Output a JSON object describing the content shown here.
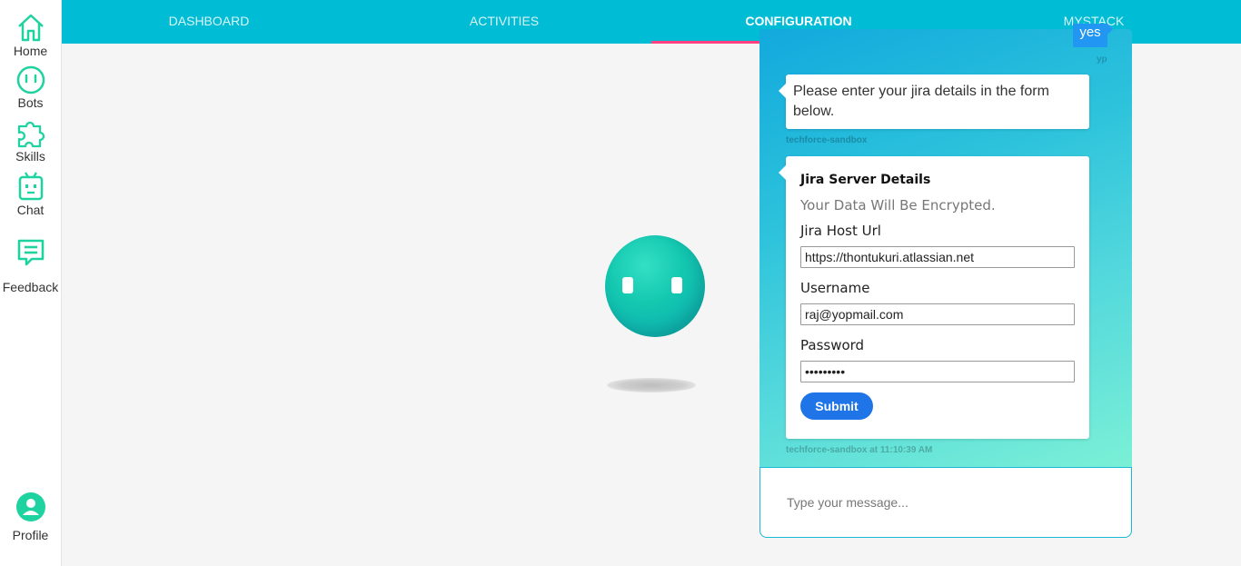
{
  "sidebar": {
    "items": [
      {
        "label": "Home",
        "icon": "home-icon"
      },
      {
        "label": "Bots",
        "icon": "bot-face-icon"
      },
      {
        "label": "Skills",
        "icon": "puzzle-icon"
      },
      {
        "label": "Chat",
        "icon": "robot-icon"
      },
      {
        "label": "Feedback",
        "icon": "feedback-icon"
      }
    ],
    "profile": {
      "label": "Profile",
      "icon": "profile-icon"
    }
  },
  "topbar": {
    "tabs": [
      {
        "label": "DASHBOARD"
      },
      {
        "label": "ACTIVITIES"
      },
      {
        "label": "CONFIGURATION",
        "active": true
      },
      {
        "label": "MYSTACK"
      }
    ]
  },
  "chat": {
    "user_message": "yes",
    "user_tag": "yp",
    "bot_message": "Please enter your jira details in the form below.",
    "bot_sender": "techforce-sandbox",
    "form": {
      "title": "Jira Server Details",
      "subtitle": "Your Data Will Be Encrypted.",
      "host_label": "Jira Host Url",
      "host_value": "https://thontukuri.atlassian.net",
      "username_label": "Username",
      "username_value": "raj@yopmail.com",
      "password_label": "Password",
      "password_value": "•••••••••",
      "submit_label": "Submit"
    },
    "form_sender": "techforce-sandbox at 11:10:39 AM",
    "input_placeholder": "Type your message..."
  },
  "colors": {
    "accent": "#00bcd4",
    "sidebar_icon": "#1ed3a0",
    "tab_indicator": "#ff4081",
    "submit": "#1f74e8"
  }
}
